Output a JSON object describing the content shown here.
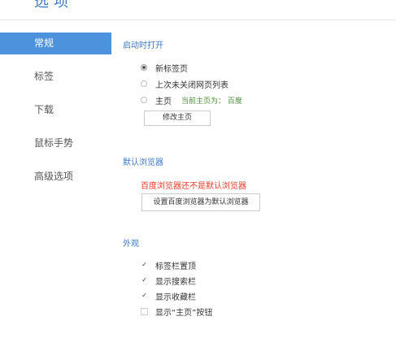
{
  "header": {
    "title": "选项"
  },
  "sidebar": {
    "items": [
      {
        "label": "常规"
      },
      {
        "label": "标签"
      },
      {
        "label": "下载"
      },
      {
        "label": "鼠标手势"
      },
      {
        "label": "高级选项"
      }
    ],
    "active_index": 0
  },
  "startup": {
    "title": "启动时打开",
    "options": [
      {
        "label": "新标签页",
        "checked": true
      },
      {
        "label": "上次未关闭网页列表",
        "checked": false
      },
      {
        "label": "主页",
        "checked": false
      }
    ],
    "homepage_note": "当前主页为： 百度",
    "edit_homepage_label": "修改主页"
  },
  "default_browser": {
    "title": "默认浏览器",
    "warning": "百度浏览器还不是默认浏览器",
    "set_default_label": "设置百度浏览器为默认浏览器"
  },
  "appearance": {
    "title": "外观",
    "options": [
      {
        "label": "标签栏置顶",
        "checked": true
      },
      {
        "label": "显示搜索栏",
        "checked": true
      },
      {
        "label": "显示收藏栏",
        "checked": true
      },
      {
        "label": "显示“主页”按钮",
        "checked": false
      }
    ]
  },
  "colors": {
    "accent": "#4c92dc",
    "title_blue": "#3c78c8",
    "warning_red": "#e83a2a",
    "note_green": "#4a8f3a"
  }
}
